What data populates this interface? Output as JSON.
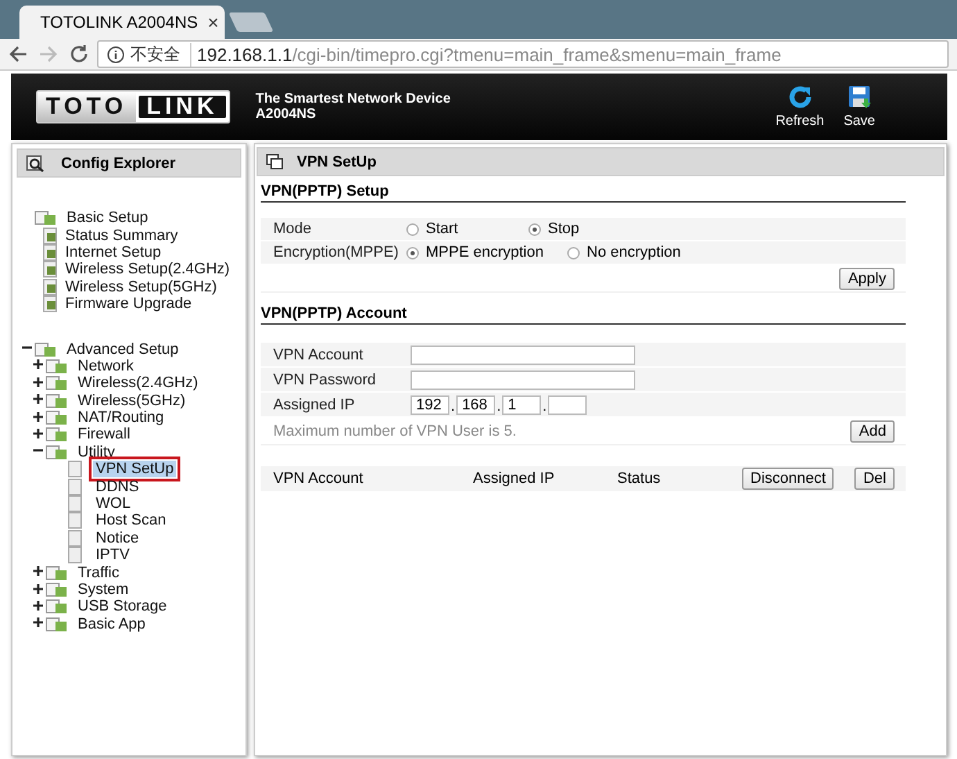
{
  "browser": {
    "tab_title": "TOTOLINK A2004NS",
    "tab_close": "×",
    "security": "不安全",
    "url_host": "192.168.1.1",
    "url_path": "/cgi-bin/timepro.cgi?tmenu=main_frame&smenu=main_frame"
  },
  "header": {
    "logo_left": "TOTO",
    "logo_right": "LINK",
    "tagline": "The Smartest Network Device",
    "model": "A2004NS",
    "actions": [
      {
        "label": "Refresh",
        "kind": "refresh"
      },
      {
        "label": "Save",
        "kind": "save"
      }
    ]
  },
  "sidebar": {
    "title": "Config Explorer",
    "tree": [
      {
        "label": "Basic Setup",
        "selected": false,
        "children": [
          {
            "label": "Status Summary",
            "selected": false
          },
          {
            "label": "Internet Setup",
            "selected": false
          },
          {
            "label": "Wireless Setup(2.4GHz)",
            "selected": false
          },
          {
            "label": "Wireless Setup(5GHz)",
            "selected": false
          },
          {
            "label": "Firmware Upgrade",
            "selected": false
          }
        ]
      },
      {
        "label": "Advanced Setup",
        "selected": false,
        "expanded": true,
        "children": [
          {
            "label": "Network",
            "selected": false,
            "expanded": false
          },
          {
            "label": "Wireless(2.4GHz)",
            "selected": false,
            "expanded": false
          },
          {
            "label": "Wireless(5GHz)",
            "selected": false,
            "expanded": false
          },
          {
            "label": "NAT/Routing",
            "selected": false,
            "expanded": false
          },
          {
            "label": "Firewall",
            "selected": false,
            "expanded": false
          },
          {
            "label": "Utility",
            "selected": false,
            "expanded": true,
            "children": [
              {
                "label": "VPN SetUp",
                "selected": true
              },
              {
                "label": "DDNS",
                "selected": false
              },
              {
                "label": "WOL",
                "selected": false
              },
              {
                "label": "Host Scan",
                "selected": false
              },
              {
                "label": "Notice",
                "selected": false
              },
              {
                "label": "IPTV",
                "selected": false
              }
            ]
          },
          {
            "label": "Traffic",
            "selected": false,
            "expanded": false
          },
          {
            "label": "System",
            "selected": false,
            "expanded": false
          },
          {
            "label": "USB Storage",
            "selected": false,
            "expanded": false
          },
          {
            "label": "Basic App",
            "selected": false,
            "expanded": false
          }
        ]
      }
    ]
  },
  "main": {
    "title": "VPN SetUp",
    "setup": {
      "heading": "VPN(PPTP) Setup",
      "rows": [
        {
          "label": "Mode",
          "options": [
            {
              "label": "Start",
              "selected": false
            },
            {
              "label": "Stop",
              "selected": true
            }
          ]
        },
        {
          "label": "Encryption(MPPE)",
          "options": [
            {
              "label": "MPPE encryption",
              "selected": true
            },
            {
              "label": "No encryption",
              "selected": false
            }
          ]
        }
      ],
      "button": "Apply"
    },
    "account": {
      "heading": "VPN(PPTP) Account",
      "account_label": "VPN Account",
      "password_label": "VPN Password",
      "ip_label": "Assigned IP",
      "ip_parts": [
        "192",
        "168",
        "1"
      ],
      "ip_separator": ".",
      "note": "Maximum number of VPN User is 5.",
      "button": "Add"
    },
    "list": {
      "columns": [
        "VPN Account",
        "Assigned IP",
        "Status"
      ],
      "buttons": [
        "Disconnect",
        "Del"
      ]
    }
  }
}
